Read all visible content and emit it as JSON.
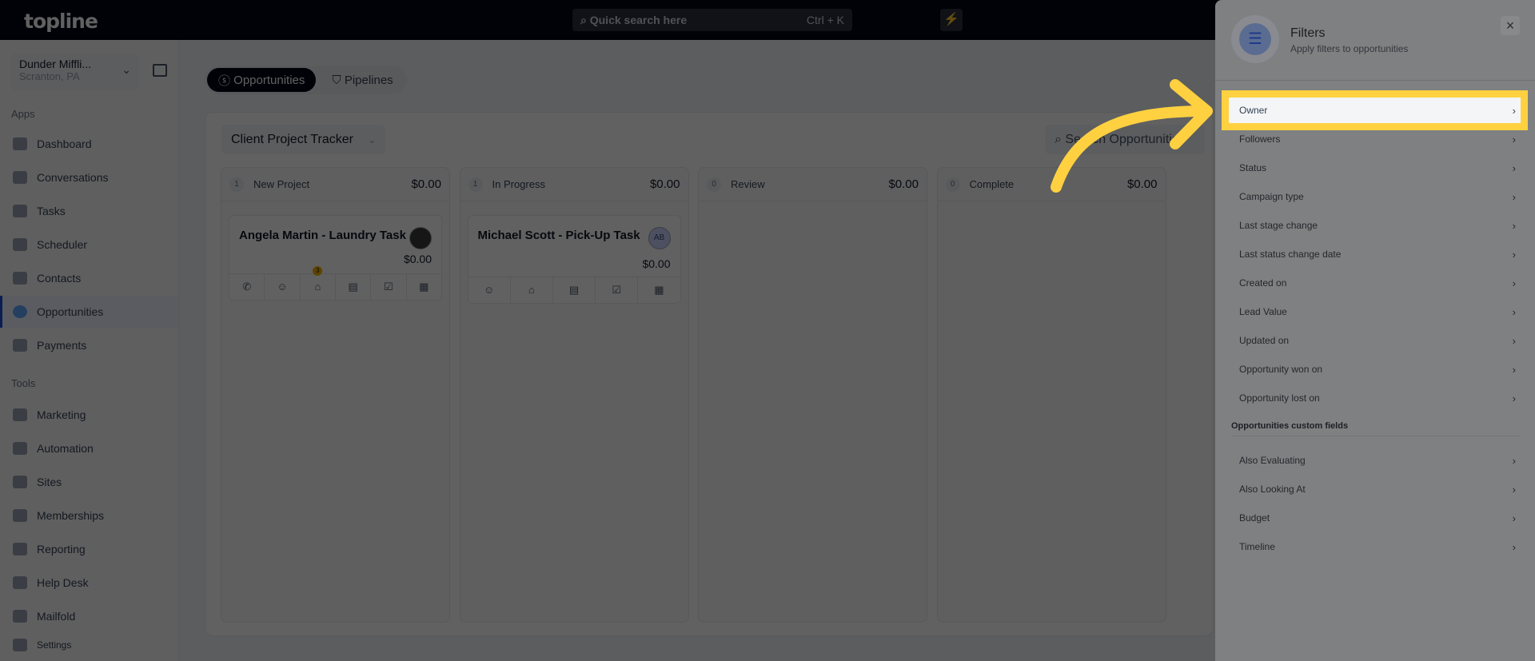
{
  "topbar": {
    "logo": "topline",
    "search_placeholder": "Quick search here",
    "search_shortcut": "Ctrl + K"
  },
  "sidebar": {
    "account_name": "Dunder Miffli...",
    "account_location": "Scranton, PA",
    "apps_label": "Apps",
    "tools_label": "Tools",
    "apps": [
      {
        "label": "Dashboard",
        "icon": "dashboard-icon"
      },
      {
        "label": "Conversations",
        "icon": "chat-icon"
      },
      {
        "label": "Tasks",
        "icon": "task-icon"
      },
      {
        "label": "Scheduler",
        "icon": "calendar-icon"
      },
      {
        "label": "Contacts",
        "icon": "user-icon"
      },
      {
        "label": "Opportunities",
        "icon": "target-icon",
        "active": true
      },
      {
        "label": "Payments",
        "icon": "card-icon"
      }
    ],
    "tools": [
      {
        "label": "Marketing",
        "icon": "megaphone-icon"
      },
      {
        "label": "Automation",
        "icon": "gears-icon"
      },
      {
        "label": "Sites",
        "icon": "globe-icon"
      },
      {
        "label": "Memberships",
        "icon": "users-icon"
      },
      {
        "label": "Reporting",
        "icon": "pie-icon"
      },
      {
        "label": "Help Desk",
        "icon": "help-icon"
      },
      {
        "label": "Mailfold",
        "icon": "mail-icon"
      }
    ],
    "settings": "Settings"
  },
  "main": {
    "tabs": [
      {
        "label": "Opportunities",
        "active": true
      },
      {
        "label": "Pipelines"
      }
    ],
    "pipeline": "Client Project Tracker",
    "search_placeholder": "Search Opportunities",
    "columns": [
      {
        "count": "1",
        "name": "New Project",
        "amount": "$0.00",
        "cards": [
          {
            "title": "Angela Martin - Laundry Task",
            "value": "$0.00",
            "avatar": "photo",
            "tag_badge": "3"
          }
        ]
      },
      {
        "count": "1",
        "name": "In Progress",
        "amount": "$0.00",
        "cards": [
          {
            "title": "Michael Scott - Pick-Up Task",
            "value": "$0.00",
            "avatar": "AB"
          }
        ]
      },
      {
        "count": "0",
        "name": "Review",
        "amount": "$0.00",
        "cards": []
      },
      {
        "count": "0",
        "name": "Complete",
        "amount": "$0.00",
        "cards": []
      }
    ]
  },
  "filters": {
    "title": "Filters",
    "subtitle": "Apply filters to opportunities",
    "items": [
      "Owner",
      "Followers",
      "Status",
      "Campaign type",
      "Last stage change",
      "Last status change date",
      "Created on",
      "Lead Value",
      "Updated on",
      "Opportunity won on",
      "Opportunity lost on"
    ],
    "custom_section": "Opportunities custom fields",
    "custom_items": [
      "Also Evaluating",
      "Also Looking At",
      "Budget",
      "Timeline"
    ],
    "highlighted": "Owner"
  },
  "colors": {
    "highlight": "#ffd140",
    "topbar": "#010616",
    "accent": "#1d4ed8"
  }
}
